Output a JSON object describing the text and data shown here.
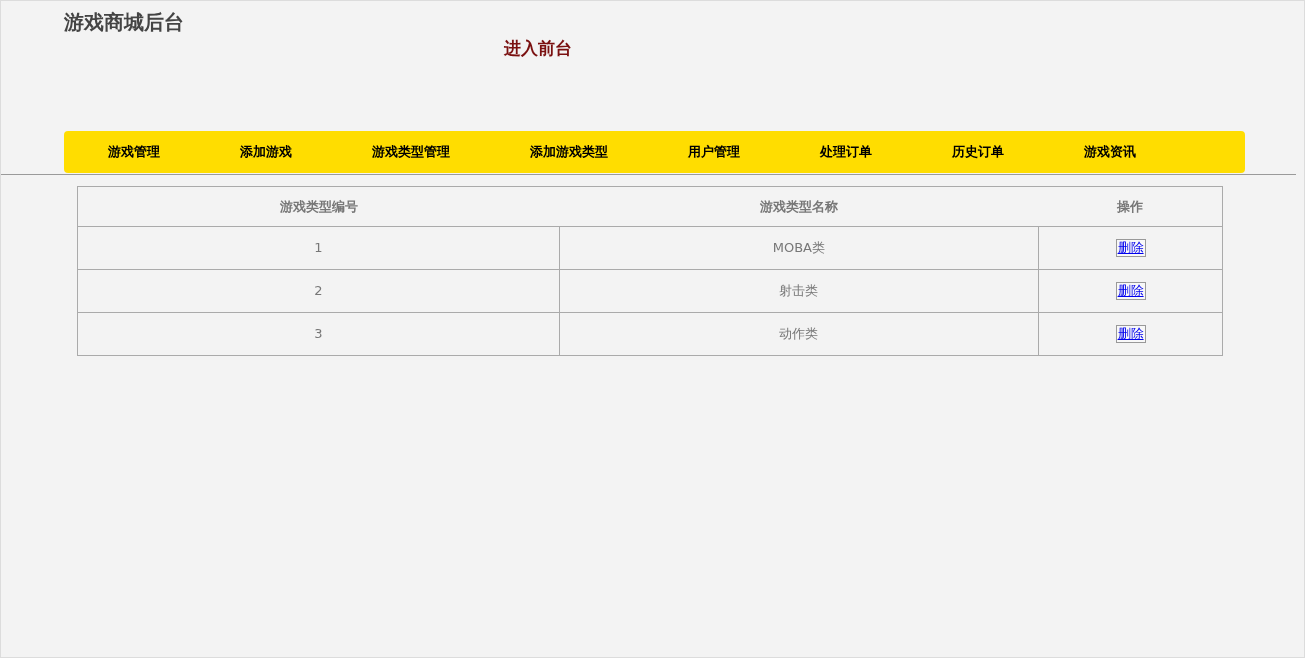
{
  "header": {
    "title": "游戏商城后台",
    "front_link": "进入前台"
  },
  "nav": [
    {
      "label": "游戏管理"
    },
    {
      "label": "添加游戏"
    },
    {
      "label": "游戏类型管理"
    },
    {
      "label": "添加游戏类型"
    },
    {
      "label": "用户管理"
    },
    {
      "label": "处理订单"
    },
    {
      "label": "历史订单"
    },
    {
      "label": "游戏资讯"
    }
  ],
  "table": {
    "columns": [
      "游戏类型编号",
      "游戏类型名称",
      "操作"
    ],
    "rows": [
      {
        "id": "1",
        "name": "MOBA类",
        "action": "删除"
      },
      {
        "id": "2",
        "name": "射击类",
        "action": "删除"
      },
      {
        "id": "3",
        "name": "动作类",
        "action": "删除"
      }
    ]
  }
}
